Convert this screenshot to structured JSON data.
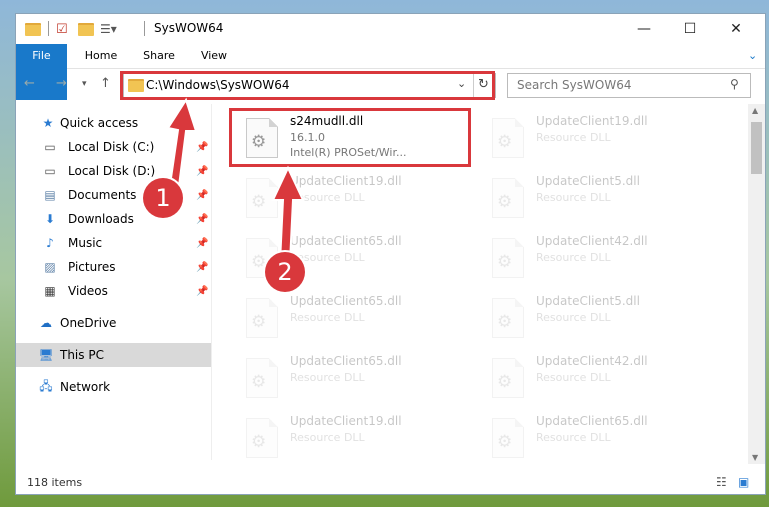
{
  "window": {
    "title": "SysWOW64",
    "minimize": "—",
    "maximize": "☐",
    "close": "✕"
  },
  "ribbon": {
    "tabs": [
      "File",
      "Home",
      "Share",
      "View"
    ]
  },
  "address": {
    "path": "C:\\Windows\\SysWOW64"
  },
  "search": {
    "placeholder": "Search SysWOW64"
  },
  "nav": {
    "items": [
      {
        "label": "Quick access",
        "icon": "star-icon"
      },
      {
        "label": "Local Disk (C:)",
        "icon": "drive-icon",
        "pinned": true
      },
      {
        "label": "Local Disk (D:)",
        "icon": "drive-icon",
        "pinned": true
      },
      {
        "label": "Documents",
        "icon": "documents-icon",
        "pinned": true
      },
      {
        "label": "Downloads",
        "icon": "download-icon",
        "pinned": true
      },
      {
        "label": "Music",
        "icon": "music-icon",
        "pinned": true
      },
      {
        "label": "Pictures",
        "icon": "pictures-icon",
        "pinned": true
      },
      {
        "label": "Videos",
        "icon": "videos-icon",
        "pinned": true
      },
      {
        "label": "OneDrive",
        "icon": "cloud-icon"
      },
      {
        "label": "This PC",
        "icon": "computer-icon",
        "selected": true
      },
      {
        "label": "Network",
        "icon": "network-icon"
      }
    ]
  },
  "files": [
    {
      "name": "s24mudll.dll",
      "line2": "16.1.0",
      "line3": "Intel(R) PROSet/Wir...",
      "highlighted": true
    },
    {
      "name": "UpdateClient19.dll",
      "line2": "Resource DLL"
    },
    {
      "name": "UpdateClient19.dll",
      "line2": "Resource DLL"
    },
    {
      "name": "UpdateClient5.dll",
      "line2": "Resource DLL"
    },
    {
      "name": "UpdateClient65.dll",
      "line2": "Resource DLL"
    },
    {
      "name": "UpdateClient42.dll",
      "line2": "Resource DLL"
    },
    {
      "name": "UpdateClient65.dll",
      "line2": "Resource DLL"
    },
    {
      "name": "UpdateClient5.dll",
      "line2": "Resource DLL"
    },
    {
      "name": "UpdateClient65.dll",
      "line2": "Resource DLL"
    },
    {
      "name": "UpdateClient42.dll",
      "line2": "Resource DLL"
    },
    {
      "name": "UpdateClient19.dll",
      "line2": "Resource DLL"
    },
    {
      "name": "UpdateClient65.dll",
      "line2": "Resource DLL"
    }
  ],
  "status": {
    "count": "118 items"
  },
  "annotations": {
    "step1": "1",
    "step2": "2",
    "color": "#d9383c"
  }
}
